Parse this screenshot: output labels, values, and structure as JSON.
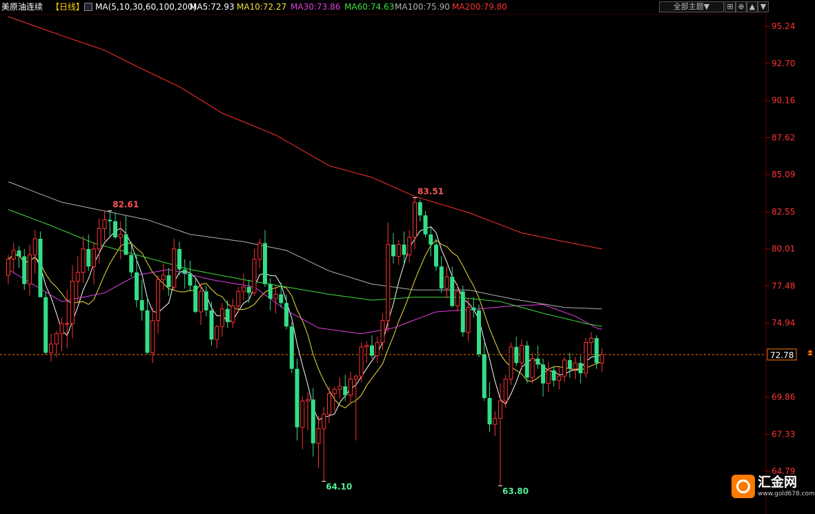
{
  "header": {
    "symbol": "美原油连续",
    "period": "【日线】",
    "ma_def": "MA(5,10,30,60,100,200)",
    "ma_values": [
      {
        "label": "MA5:72.93",
        "color": "#ffffff"
      },
      {
        "label": "MA10:72.27",
        "color": "#f0e040"
      },
      {
        "label": "MA30:73.86",
        "color": "#e040e0"
      },
      {
        "label": "MA60:74.63",
        "color": "#40e040"
      },
      {
        "label": "MA100:75.90",
        "color": "#b0b0b0"
      },
      {
        "label": "MA200:79.80",
        "color": "#ff3030"
      }
    ]
  },
  "toolbar": {
    "theme_label": "全部主题▼",
    "icons": [
      "grid-icon",
      "zoom-icon",
      "arrow-up-icon",
      "arrow-down-icon"
    ]
  },
  "logo": {
    "name": "汇金网",
    "url": "www.gold678.com"
  },
  "colors": {
    "up": "#ff3333",
    "down": "#33dd88",
    "axis_text": "#ff3333",
    "grid": "#3a0000",
    "current": "#ff7a00"
  },
  "chart_data": {
    "type": "candlestick",
    "price_axis_ticks": [
      "95.24",
      "92.70",
      "90.16",
      "87.62",
      "85.09",
      "82.55",
      "80.01",
      "77.48",
      "74.94",
      "69.86",
      "67.33",
      "64.79"
    ],
    "ylim": [
      63.0,
      96.0
    ],
    "current_price": "72.78",
    "annotations": [
      {
        "text": "82.61",
        "index": 19,
        "value": 82.61
      },
      {
        "text": "64.10",
        "index": 59,
        "value": 64.1
      },
      {
        "text": "83.51",
        "index": 76,
        "value": 83.51
      },
      {
        "text": "63.80",
        "index": 92,
        "value": 63.8
      }
    ],
    "candles": [
      [
        78.2,
        79.6,
        77.6,
        79.3
      ],
      [
        79.3,
        80.4,
        78.4,
        79.9
      ],
      [
        79.9,
        80.2,
        78.7,
        79.5
      ],
      [
        79.5,
        80.0,
        77.2,
        77.6
      ],
      [
        77.6,
        80.3,
        76.8,
        79.6
      ],
      [
        79.6,
        81.3,
        78.3,
        80.7
      ],
      [
        80.7,
        81.2,
        77.0,
        76.7
      ],
      [
        76.7,
        77.1,
        72.8,
        72.9
      ],
      [
        72.9,
        74.2,
        72.3,
        73.5
      ],
      [
        73.5,
        74.4,
        72.6,
        74.2
      ],
      [
        74.2,
        75.3,
        73.0,
        74.9
      ],
      [
        74.9,
        77.2,
        73.2,
        74.9
      ],
      [
        74.9,
        78.9,
        73.9,
        77.8
      ],
      [
        77.8,
        79.5,
        76.3,
        78.4
      ],
      [
        78.4,
        80.9,
        77.7,
        80.0
      ],
      [
        80.0,
        81.0,
        78.5,
        78.8
      ],
      [
        78.8,
        80.4,
        77.6,
        80.0
      ],
      [
        80.0,
        82.1,
        79.0,
        81.4
      ],
      [
        81.4,
        82.6,
        80.6,
        82.0
      ],
      [
        82.0,
        82.61,
        80.9,
        81.9
      ],
      [
        81.9,
        82.5,
        80.7,
        80.8
      ],
      [
        80.8,
        81.9,
        79.3,
        81.0
      ],
      [
        81.0,
        82.3,
        79.8,
        79.6
      ],
      [
        79.6,
        80.5,
        78.1,
        78.4
      ],
      [
        78.4,
        79.6,
        76.0,
        76.5
      ],
      [
        76.5,
        77.9,
        75.1,
        75.8
      ],
      [
        75.8,
        76.7,
        72.8,
        72.9
      ],
      [
        72.9,
        76.0,
        72.2,
        75.1
      ],
      [
        75.1,
        78.2,
        74.2,
        77.9
      ],
      [
        77.9,
        79.0,
        77.2,
        78.2
      ],
      [
        78.2,
        78.7,
        76.8,
        77.4
      ],
      [
        77.4,
        80.7,
        77.2,
        80.0
      ],
      [
        80.0,
        80.5,
        78.2,
        78.6
      ],
      [
        78.6,
        79.3,
        77.3,
        78.3
      ],
      [
        78.3,
        79.2,
        77.1,
        77.5
      ],
      [
        77.5,
        78.0,
        75.6,
        75.7
      ],
      [
        75.7,
        77.6,
        74.8,
        77.1
      ],
      [
        77.1,
        77.5,
        75.4,
        75.8
      ],
      [
        75.8,
        76.4,
        73.4,
        73.8
      ],
      [
        73.8,
        74.8,
        73.2,
        74.7
      ],
      [
        74.7,
        76.3,
        74.0,
        75.9
      ],
      [
        75.9,
        76.5,
        74.6,
        75.0
      ],
      [
        75.0,
        76.6,
        74.6,
        76.1
      ],
      [
        76.1,
        77.4,
        75.6,
        77.1
      ],
      [
        77.1,
        78.3,
        76.5,
        77.4
      ],
      [
        77.4,
        77.9,
        76.3,
        77.0
      ],
      [
        77.0,
        80.0,
        76.8,
        79.3
      ],
      [
        79.3,
        80.7,
        78.7,
        80.4
      ],
      [
        80.4,
        81.3,
        77.4,
        77.6
      ],
      [
        77.6,
        78.0,
        75.8,
        76.6
      ],
      [
        76.6,
        77.5,
        75.6,
        76.9
      ],
      [
        76.9,
        77.7,
        76.0,
        76.3
      ],
      [
        76.3,
        76.9,
        74.5,
        74.7
      ],
      [
        74.7,
        75.0,
        71.5,
        71.8
      ],
      [
        71.8,
        72.5,
        66.9,
        67.8
      ],
      [
        67.8,
        69.9,
        66.3,
        69.6
      ],
      [
        69.6,
        70.2,
        67.6,
        69.7
      ],
      [
        69.7,
        70.5,
        65.8,
        66.7
      ],
      [
        66.7,
        68.6,
        65.0,
        67.7
      ],
      [
        67.7,
        69.2,
        64.1,
        68.7
      ],
      [
        68.7,
        70.6,
        68.1,
        70.1
      ],
      [
        70.1,
        70.6,
        68.9,
        70.4
      ],
      [
        70.4,
        71.2,
        69.8,
        70.6
      ],
      [
        70.6,
        71.4,
        69.6,
        70.0
      ],
      [
        70.0,
        71.6,
        69.4,
        71.1
      ],
      [
        71.1,
        71.4,
        66.9,
        71.3
      ],
      [
        71.3,
        73.6,
        70.9,
        73.3
      ],
      [
        73.3,
        73.7,
        72.2,
        73.4
      ],
      [
        73.4,
        74.1,
        72.5,
        72.7
      ],
      [
        72.7,
        74.0,
        72.2,
        73.6
      ],
      [
        73.6,
        75.6,
        73.1,
        75.1
      ],
      [
        75.1,
        81.8,
        74.3,
        80.3
      ],
      [
        80.3,
        81.1,
        79.0,
        79.5
      ],
      [
        79.5,
        80.6,
        78.9,
        80.3
      ],
      [
        80.3,
        81.2,
        79.0,
        79.6
      ],
      [
        79.6,
        81.3,
        79.1,
        80.8
      ],
      [
        80.8,
        83.51,
        80.0,
        83.2
      ],
      [
        83.2,
        83.4,
        81.9,
        82.3
      ],
      [
        82.3,
        82.6,
        80.8,
        81.0
      ],
      [
        81.0,
        81.5,
        79.5,
        80.3
      ],
      [
        80.3,
        80.7,
        78.5,
        78.8
      ],
      [
        78.8,
        79.5,
        77.0,
        77.3
      ],
      [
        77.3,
        78.8,
        76.6,
        78.1
      ],
      [
        78.1,
        78.8,
        76.0,
        76.1
      ],
      [
        76.1,
        77.6,
        75.7,
        77.1
      ],
      [
        77.1,
        77.5,
        74.0,
        74.3
      ],
      [
        74.3,
        76.6,
        73.7,
        76.0
      ],
      [
        76.0,
        76.7,
        75.3,
        75.8
      ],
      [
        75.8,
        76.2,
        72.6,
        72.8
      ],
      [
        72.8,
        73.6,
        69.6,
        69.8
      ],
      [
        69.8,
        70.9,
        67.5,
        68.0
      ],
      [
        68.0,
        68.9,
        67.2,
        68.4
      ],
      [
        68.4,
        70.8,
        63.8,
        69.6
      ],
      [
        69.6,
        71.4,
        69.1,
        71.1
      ],
      [
        71.1,
        73.6,
        70.7,
        73.3
      ],
      [
        73.3,
        74.0,
        72.0,
        72.2
      ],
      [
        72.2,
        73.8,
        71.7,
        73.4
      ],
      [
        73.4,
        73.7,
        70.8,
        71.2
      ],
      [
        71.2,
        72.9,
        70.8,
        72.5
      ],
      [
        72.5,
        73.4,
        71.8,
        72.1
      ],
      [
        72.1,
        72.5,
        69.9,
        70.8
      ],
      [
        70.8,
        72.3,
        70.2,
        71.7
      ],
      [
        71.7,
        72.0,
        70.6,
        71.0
      ],
      [
        71.0,
        71.9,
        70.4,
        71.3
      ],
      [
        71.3,
        72.6,
        70.9,
        72.4
      ],
      [
        72.4,
        72.9,
        71.2,
        71.8
      ],
      [
        71.8,
        72.6,
        71.1,
        72.2
      ],
      [
        72.2,
        72.7,
        70.8,
        71.5
      ],
      [
        71.5,
        73.9,
        71.2,
        73.6
      ],
      [
        73.6,
        74.3,
        72.7,
        73.9
      ],
      [
        73.9,
        74.1,
        71.8,
        72.2
      ],
      [
        72.2,
        73.2,
        71.6,
        72.78
      ]
    ],
    "moving_averages": [
      {
        "name": "MA5",
        "period": 5,
        "color": "#ffffff"
      },
      {
        "name": "MA10",
        "period": 10,
        "color": "#f0e040"
      },
      {
        "name": "MA30",
        "period": 30,
        "color": "#e040e0"
      },
      {
        "name": "MA60",
        "period": 60,
        "color": "#40e040"
      },
      {
        "name": "MA100",
        "period": 100,
        "color": "#b0b0b0"
      },
      {
        "name": "MA200",
        "period": 200,
        "color": "#ff3030"
      }
    ],
    "long_ma_anchors": {
      "MA30": [
        [
          0,
          78.6
        ],
        [
          10,
          76.4
        ],
        [
          18,
          77.0
        ],
        [
          24,
          78.2
        ],
        [
          30,
          78.6
        ],
        [
          38,
          77.9
        ],
        [
          46,
          77.4
        ],
        [
          52,
          75.8
        ],
        [
          58,
          74.6
        ],
        [
          66,
          74.2
        ],
        [
          72,
          74.6
        ],
        [
          80,
          75.7
        ],
        [
          88,
          75.9
        ],
        [
          94,
          76.1
        ],
        [
          100,
          76.2
        ],
        [
          106,
          75.4
        ],
        [
          110,
          74.6
        ],
        [
          111,
          74.5
        ]
      ],
      "MA60": [
        [
          0,
          82.7
        ],
        [
          8,
          81.6
        ],
        [
          16,
          80.4
        ],
        [
          24,
          79.6
        ],
        [
          34,
          78.6
        ],
        [
          44,
          77.9
        ],
        [
          52,
          77.4
        ],
        [
          60,
          76.9
        ],
        [
          68,
          76.5
        ],
        [
          76,
          76.7
        ],
        [
          84,
          76.7
        ],
        [
          92,
          76.4
        ],
        [
          100,
          75.6
        ],
        [
          108,
          74.9
        ],
        [
          111,
          74.7
        ]
      ],
      "MA100": [
        [
          0,
          84.6
        ],
        [
          10,
          83.2
        ],
        [
          18,
          82.6
        ],
        [
          26,
          82.0
        ],
        [
          34,
          81.0
        ],
        [
          44,
          80.5
        ],
        [
          52,
          79.9
        ],
        [
          60,
          78.5
        ],
        [
          68,
          77.6
        ],
        [
          76,
          77.2
        ],
        [
          86,
          77.2
        ],
        [
          94,
          76.6
        ],
        [
          104,
          76.0
        ],
        [
          111,
          75.9
        ]
      ],
      "MA200": [
        [
          0,
          95.9
        ],
        [
          10,
          94.6
        ],
        [
          18,
          93.6
        ],
        [
          24,
          92.5
        ],
        [
          32,
          91.1
        ],
        [
          40,
          89.3
        ],
        [
          50,
          87.8
        ],
        [
          60,
          85.7
        ],
        [
          68,
          84.9
        ],
        [
          76,
          83.6
        ],
        [
          86,
          82.5
        ],
        [
          96,
          81.1
        ],
        [
          104,
          80.5
        ],
        [
          111,
          80.0
        ]
      ]
    }
  }
}
